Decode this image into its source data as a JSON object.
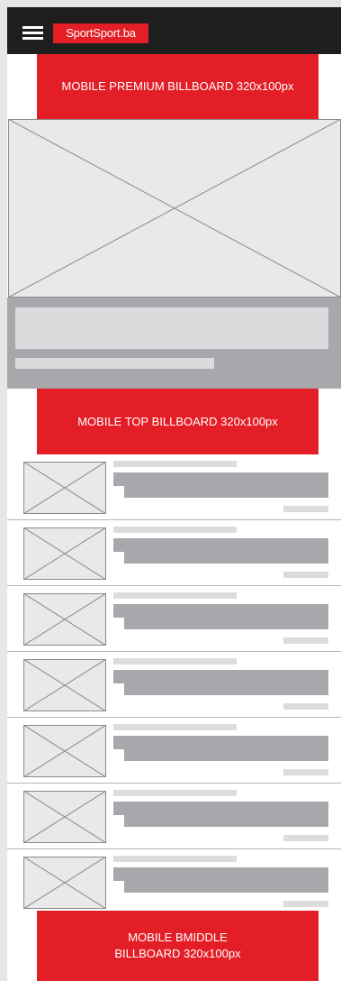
{
  "header": {
    "logo_text": "SportSport.ba",
    "menu_icon": "hamburger-menu-icon"
  },
  "ads": {
    "premium": "MOBILE PREMIUM BILLBOARD 320x100px",
    "top": "MOBILE  TOP BILLBOARD 320x100px",
    "bmiddle": "MOBILE BMIDDLE\nBILLBOARD 320x100px"
  },
  "colors": {
    "brand_red": "#e41e26",
    "header_bg": "#1e1e1e",
    "placeholder_gray": "#a6a8ab",
    "light_gray": "#dcdcdc"
  },
  "articles": [
    {
      "thumb_icon": "image-placeholder-icon"
    },
    {
      "thumb_icon": "image-placeholder-icon"
    },
    {
      "thumb_icon": "image-placeholder-icon"
    },
    {
      "thumb_icon": "image-placeholder-icon"
    },
    {
      "thumb_icon": "image-placeholder-icon"
    },
    {
      "thumb_icon": "image-placeholder-icon"
    },
    {
      "thumb_icon": "image-placeholder-icon"
    }
  ]
}
